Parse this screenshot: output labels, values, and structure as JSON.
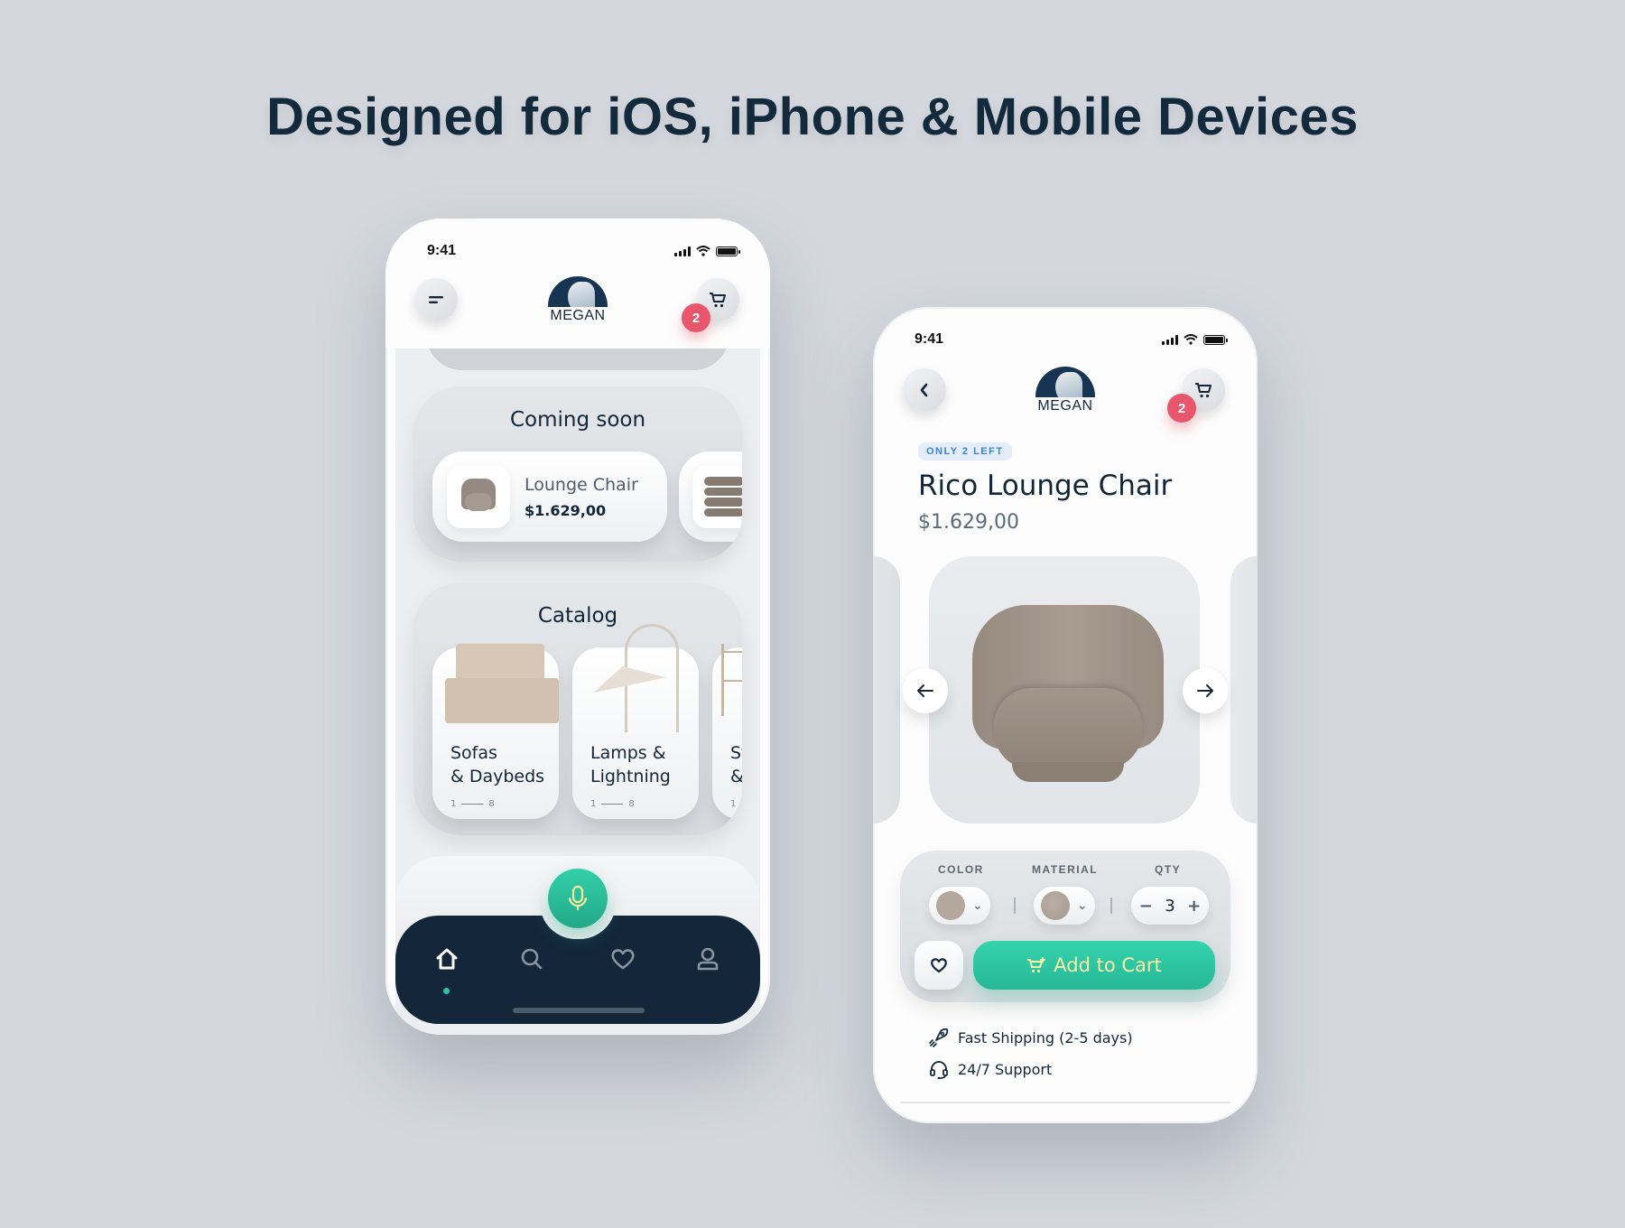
{
  "headline": "Designed for iOS, iPhone & Mobile Devices",
  "colors": {
    "background": "#d4d8de",
    "navy": "#13263a",
    "accent_green": "#2cc5a0",
    "badge_red": "#e8566b",
    "tag_blue": "#3b82d6",
    "button_text": "#f8f1a8"
  },
  "home_screen": {
    "status": {
      "time": "9:41"
    },
    "header": {
      "menu_icon": "menu-icon",
      "logo_text": "MEGAN",
      "cart_icon": "cart-icon",
      "cart_count": "2"
    },
    "coming_soon": {
      "title": "Coming soon",
      "items": [
        {
          "name": "Lounge Chair",
          "price": "$1.629,00",
          "image": "lounge-chair"
        },
        {
          "name": "",
          "price": "",
          "image": "pouf"
        }
      ]
    },
    "catalog": {
      "title": "Catalog",
      "categories": [
        {
          "line1": "Sofas",
          "line2": "& Daybeds",
          "pager_start": "1",
          "pager_end": "8",
          "image": "sofa"
        },
        {
          "line1": "Lamps &",
          "line2": "Lightning",
          "pager_start": "1",
          "pager_end": "8",
          "image": "lamp"
        },
        {
          "line1": "Stor",
          "line2": "& Sl",
          "pager_start": "1",
          "pager_end": "",
          "image": "shelf"
        }
      ]
    },
    "voice_button_icon": "microphone-icon",
    "tabbar": [
      {
        "name": "home",
        "icon": "home-icon",
        "active": true
      },
      {
        "name": "search",
        "icon": "search-icon",
        "active": false
      },
      {
        "name": "favorites",
        "icon": "heart-icon",
        "active": false
      },
      {
        "name": "profile",
        "icon": "user-icon",
        "active": false
      }
    ]
  },
  "product_screen": {
    "status": {
      "time": "9:41"
    },
    "header": {
      "back_icon": "chevron-left-icon",
      "logo_text": "MEGAN",
      "cart_icon": "cart-icon",
      "cart_count": "2"
    },
    "stock_tag": "ONLY 2 LEFT",
    "title": "Rico Lounge Chair",
    "price": "$1.629,00",
    "gallery": {
      "prev_icon": "arrow-left-icon",
      "next_icon": "arrow-right-icon"
    },
    "options": {
      "color_label": "COLOR",
      "color_value": "#b4a89c",
      "material_label": "MATERIAL",
      "material_value": "#a49a8f",
      "qty_label": "QTY",
      "qty_minus": "−",
      "qty_value": "3",
      "qty_plus": "+"
    },
    "favorite_icon": "heart-icon",
    "add_to_cart_label": "Add to Cart",
    "features": [
      {
        "icon": "rocket-icon",
        "text": "Fast Shipping (2-5 days)"
      },
      {
        "icon": "headset-icon",
        "text": "24/7 Support"
      }
    ]
  }
}
